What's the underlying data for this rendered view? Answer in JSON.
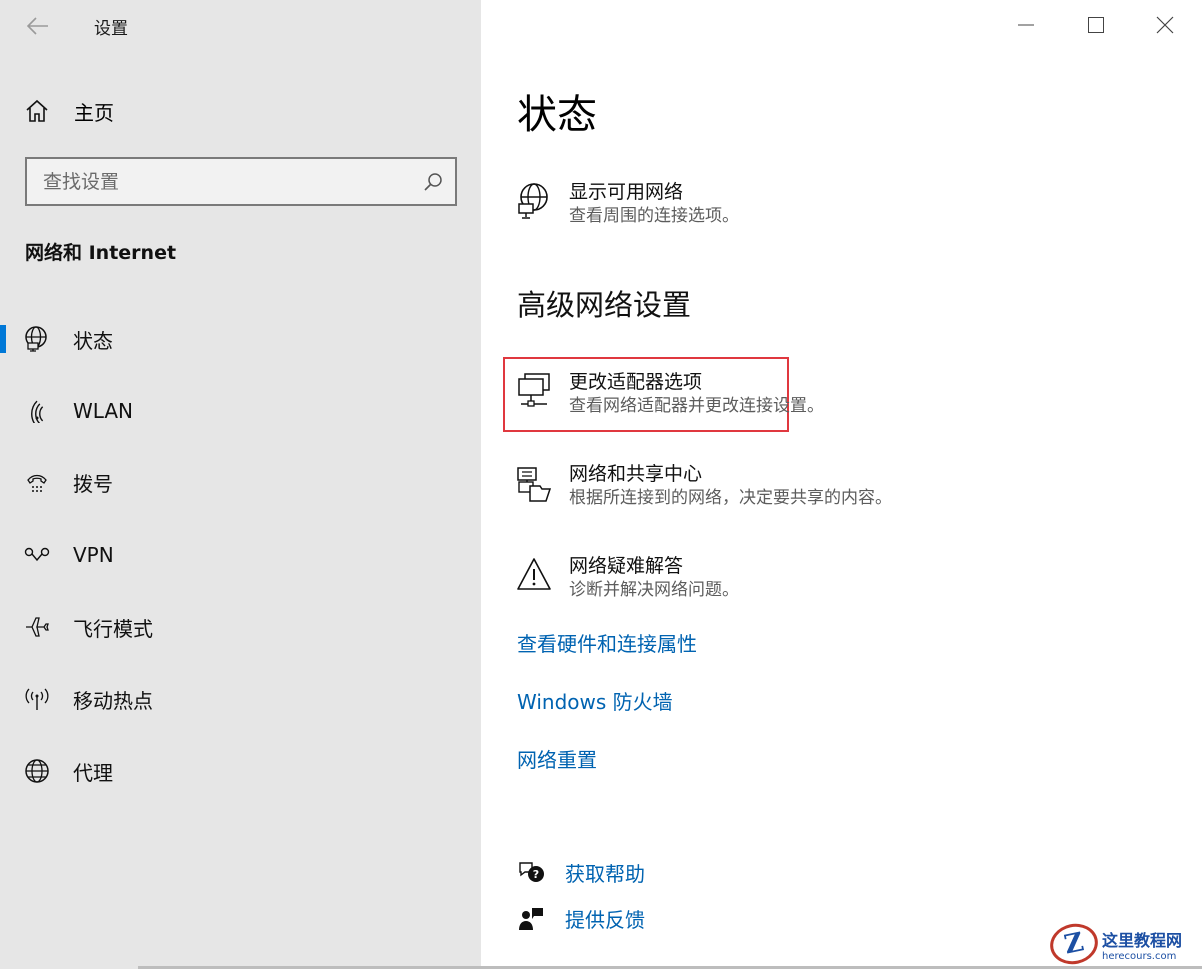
{
  "window": {
    "app_title": "设置"
  },
  "sidebar": {
    "home_label": "主页",
    "search_placeholder": "查找设置",
    "section_title": "网络和 Internet",
    "items": [
      {
        "label": "状态",
        "icon": "network-status-icon",
        "selected": true
      },
      {
        "label": "WLAN",
        "icon": "wifi-icon"
      },
      {
        "label": "拨号",
        "icon": "dial-up-icon"
      },
      {
        "label": "VPN",
        "icon": "vpn-icon"
      },
      {
        "label": "飞行模式",
        "icon": "airplane-icon"
      },
      {
        "label": "移动热点",
        "icon": "hotspot-icon"
      },
      {
        "label": "代理",
        "icon": "globe-icon"
      }
    ]
  },
  "main": {
    "page_title": "状态",
    "show_networks": {
      "title": "显示可用网络",
      "desc": "查看周围的连接选项。"
    },
    "advanced_heading": "高级网络设置",
    "adapter": {
      "title": "更改适配器选项",
      "desc": "查看网络适配器并更改连接设置。"
    },
    "sharing": {
      "title": "网络和共享中心",
      "desc": "根据所连接到的网络，决定要共享的内容。"
    },
    "troubleshoot": {
      "title": "网络疑难解答",
      "desc": "诊断并解决网络问题。"
    },
    "links": [
      "查看硬件和连接属性",
      "Windows 防火墙",
      "网络重置"
    ],
    "get_help": "获取帮助",
    "feedback": "提供反馈"
  },
  "watermark": {
    "badge": "Z",
    "name": "这里教程网",
    "url": "herecours.com"
  },
  "colors": {
    "accent": "#0078d7",
    "link": "#0063b1",
    "highlight_border": "#e0383f",
    "sidebar_bg": "#e6e6e6"
  }
}
